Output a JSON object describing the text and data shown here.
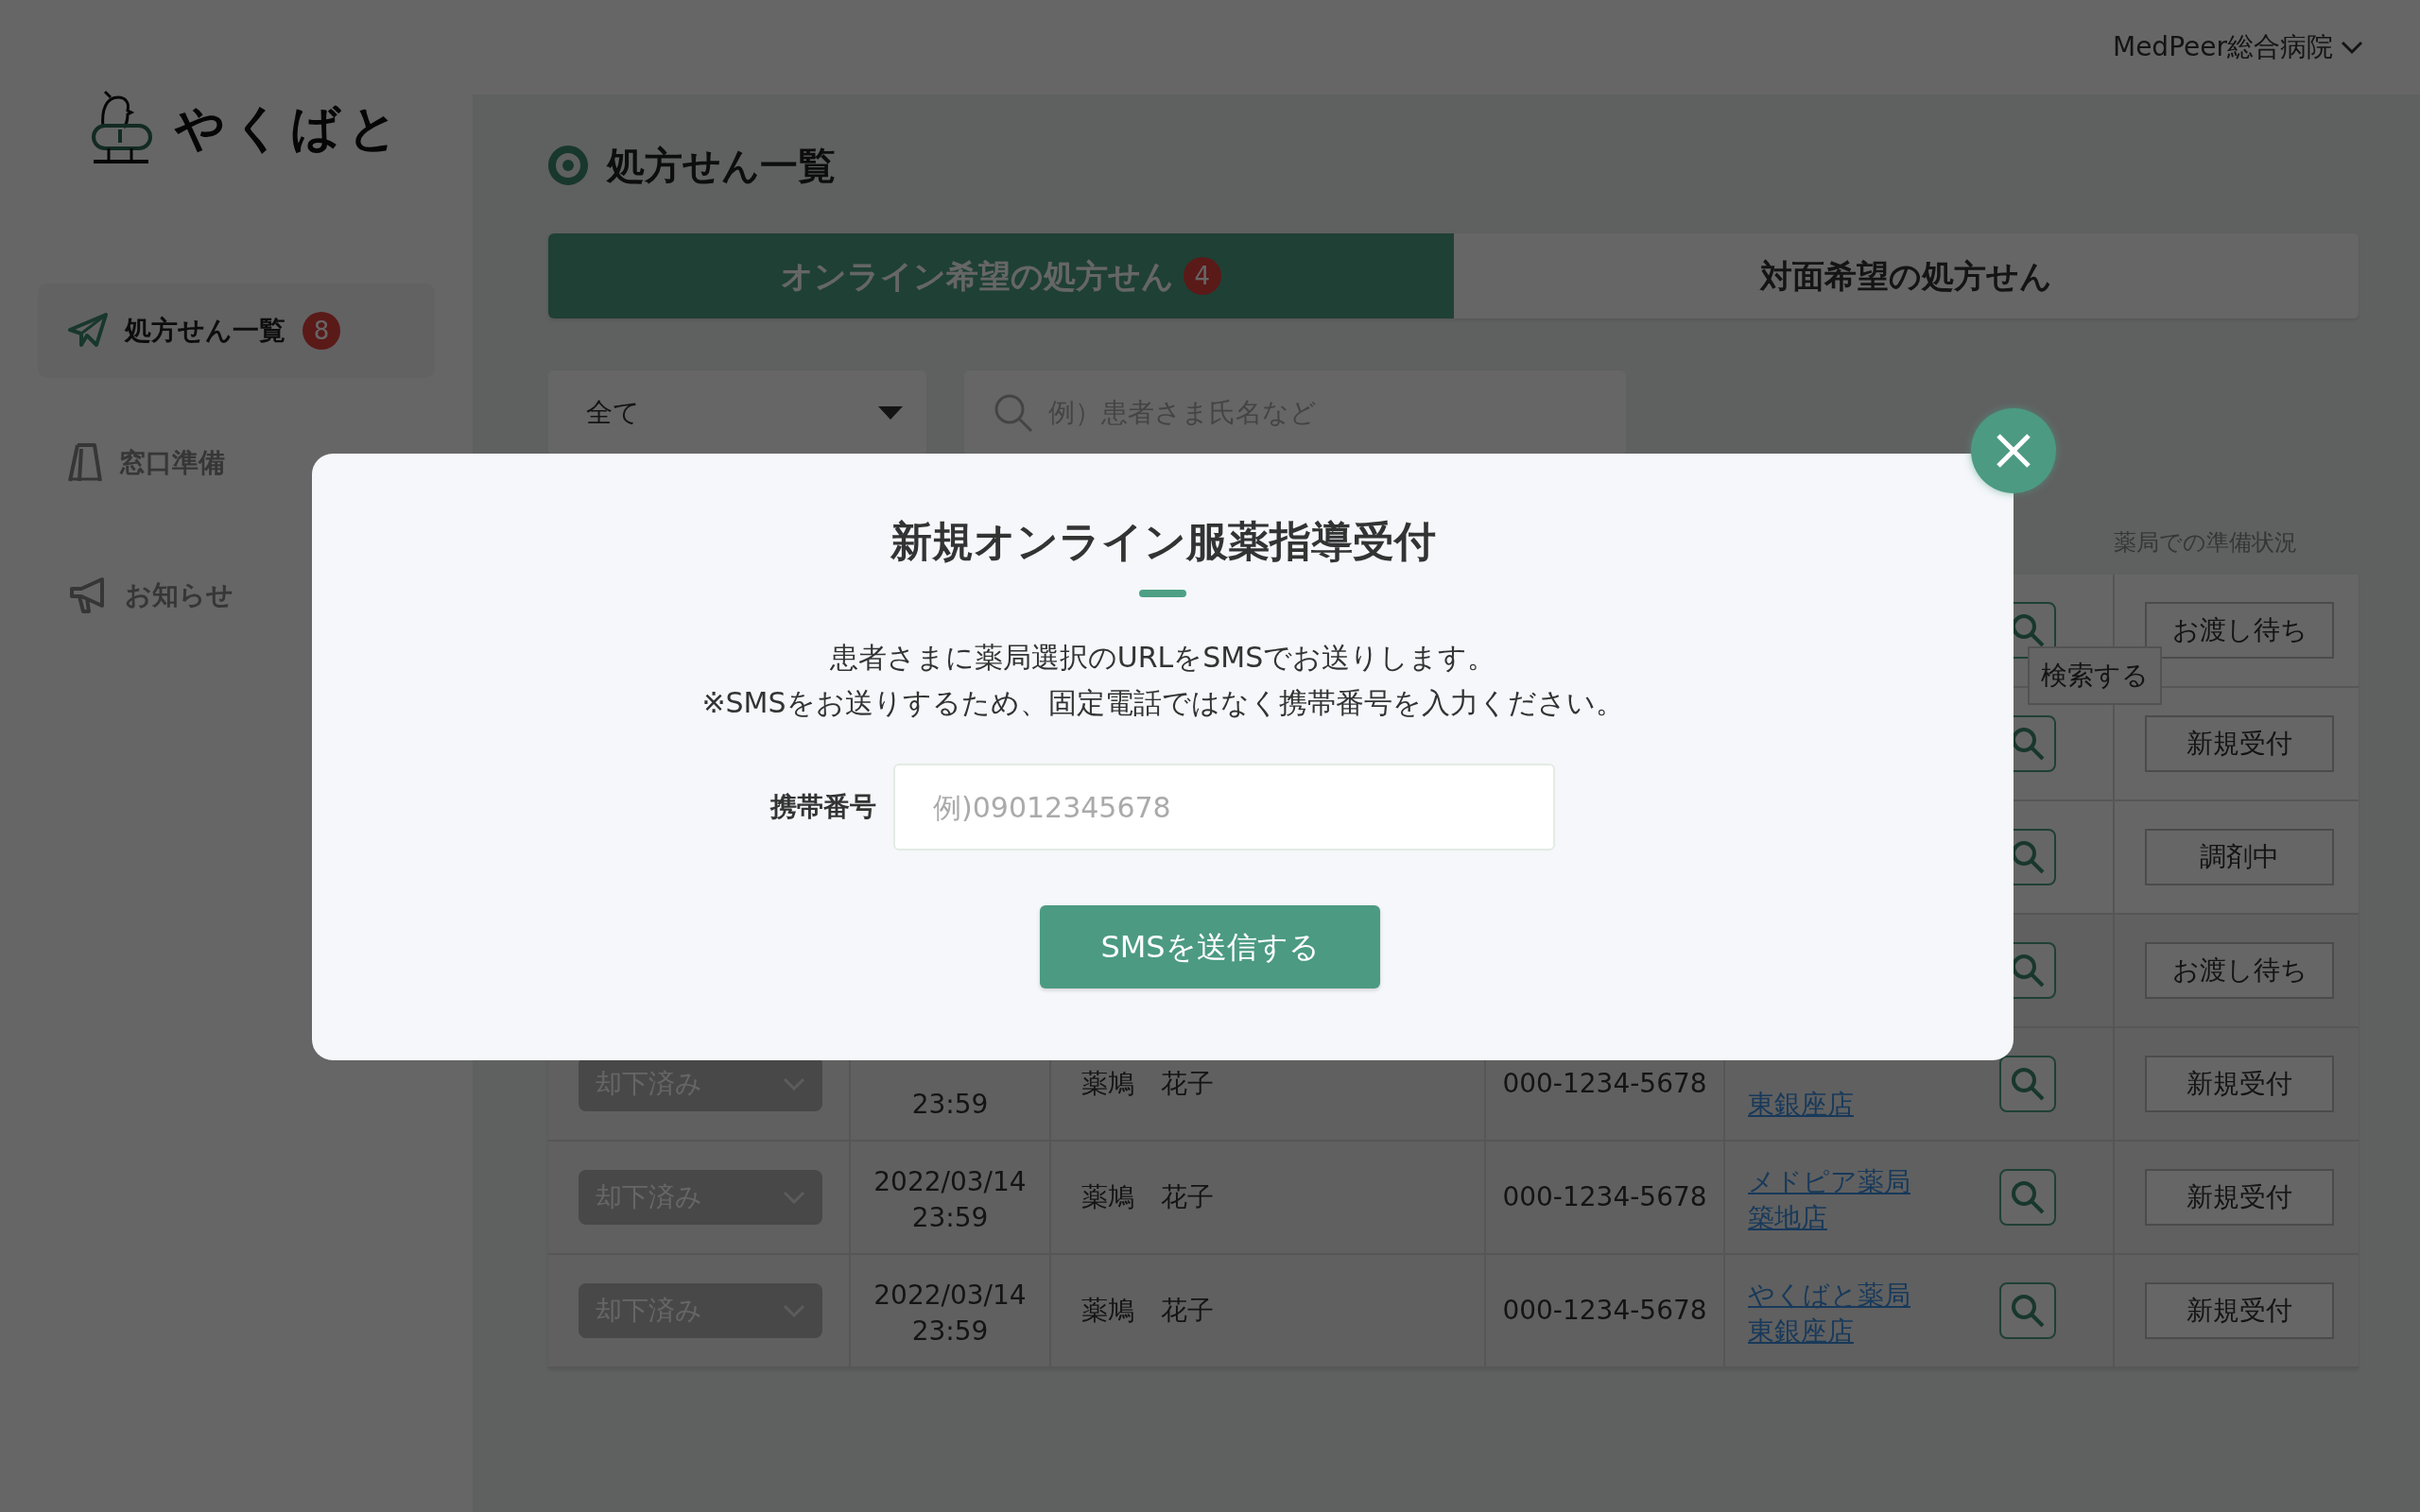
{
  "header": {
    "account": "MedPeer総合病院"
  },
  "sidebar": {
    "logo": "やくばと",
    "items": [
      {
        "label": "処方せん一覧",
        "badge": "8",
        "selected": true
      },
      {
        "label": "窓口準備",
        "selected": false
      },
      {
        "label": "お知らせ",
        "selected": false
      }
    ]
  },
  "page_title": "処方せん一覧",
  "tabs": [
    {
      "label": "オンライン希望の処方せん",
      "badge": "4",
      "selected": true
    },
    {
      "label": "対面希望の処方せん",
      "selected": false
    }
  ],
  "filter": {
    "value": "全て"
  },
  "search": {
    "placeholder": "例）患者さま氏名など"
  },
  "table": {
    "status_heading": "薬局での準備状況",
    "rows": [
      {
        "status": "お渡し待ち"
      },
      {
        "status": "新規受付",
        "tooltip": "検索する"
      },
      {
        "status": "調剤中"
      },
      {
        "status": "お渡し待ち"
      },
      {
        "decision": "却下済み",
        "date": [
          "23:59"
        ],
        "patient": "薬鳩　花子",
        "phone": "000-1234-5678",
        "pharmacy": [
          "東銀座店"
        ],
        "status": "新規受付"
      },
      {
        "decision": "却下済み",
        "date": [
          "2022/03/14",
          "23:59"
        ],
        "patient": "薬鳩　花子",
        "phone": "000-1234-5678",
        "pharmacy": [
          "メドピア薬局",
          "築地店"
        ],
        "status": "新規受付"
      },
      {
        "decision": "却下済み",
        "date": [
          "2022/03/14",
          "23:59"
        ],
        "patient": "薬鳩　花子",
        "phone": "000-1234-5678",
        "pharmacy": [
          "やくばと薬局",
          "東銀座店"
        ],
        "status": "新規受付"
      }
    ]
  },
  "modal": {
    "title": "新規オンライン服薬指導受付",
    "lines": [
      "患者さまに薬局選択のURLをSMSでお送りします。",
      "※SMSをお送りするため、固定電話ではなく携帯番号を入力ください。"
    ],
    "field": {
      "label": "携帯番号",
      "placeholder": "例)09012345678"
    },
    "button": "SMSを送信する"
  }
}
